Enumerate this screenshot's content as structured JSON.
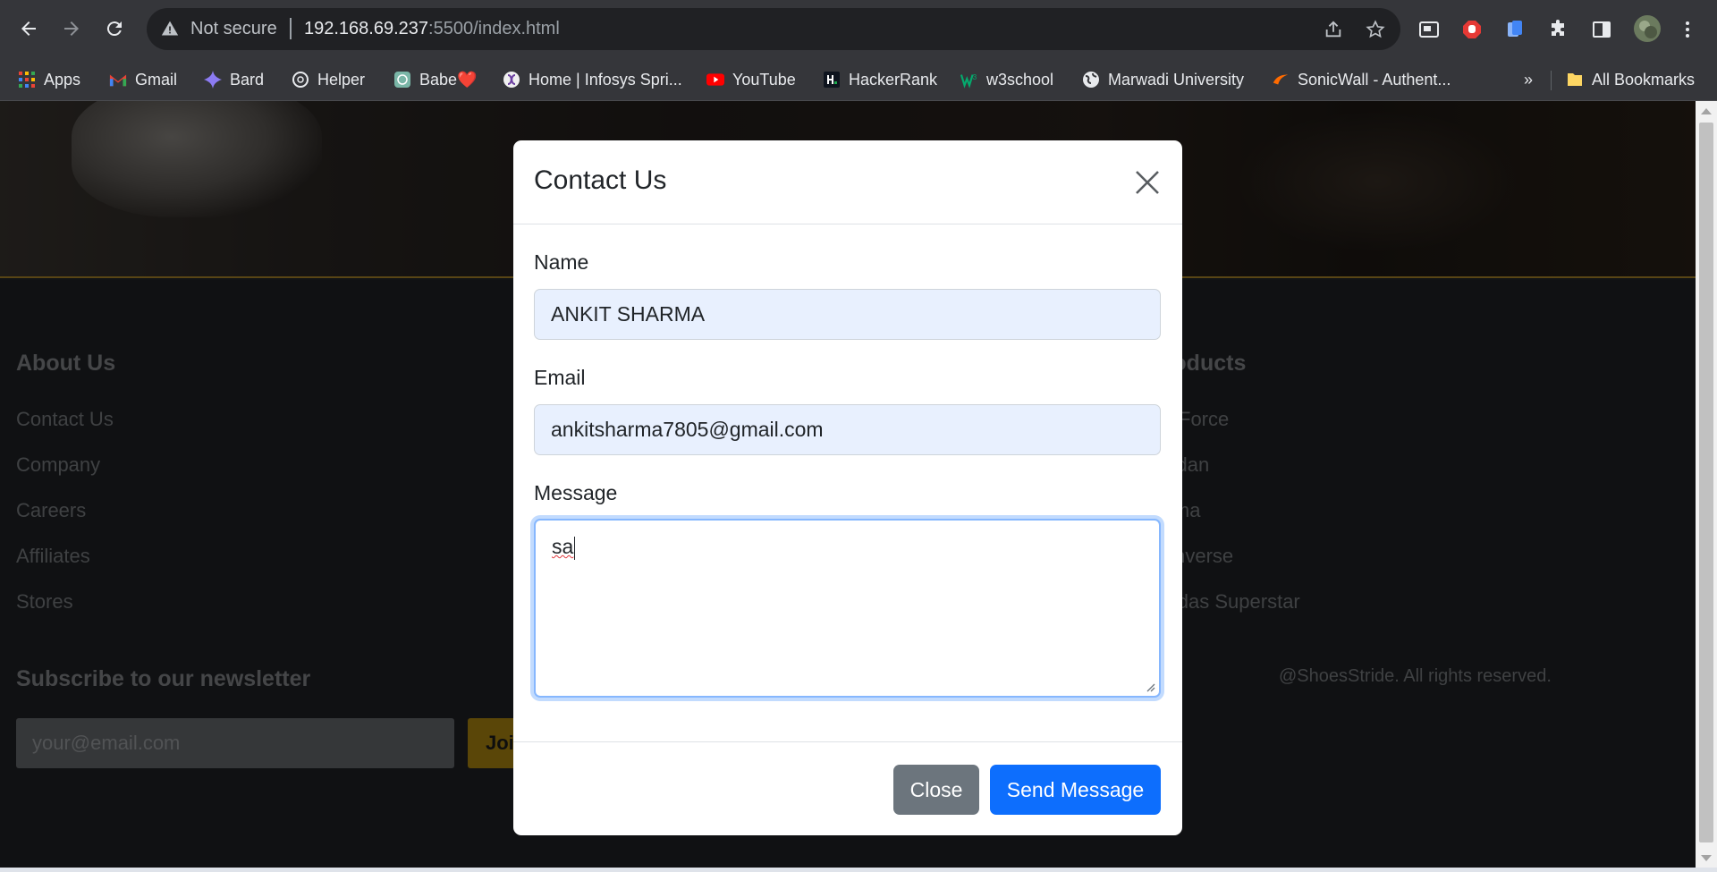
{
  "browser": {
    "security_label": "Not secure",
    "url_host": "192.168.69.237",
    "url_rest": ":5500/index.html"
  },
  "bookmarks": {
    "items": [
      {
        "label": "Apps",
        "icon": "apps-grid-icon"
      },
      {
        "label": "Gmail",
        "icon": "gmail-icon"
      },
      {
        "label": "Bard",
        "icon": "bard-sparkle-icon"
      },
      {
        "label": "Helper",
        "icon": "openai-icon"
      },
      {
        "label": "Babe❤️",
        "icon": "openai-icon"
      },
      {
        "label": "Home | Infosys Spri...",
        "icon": "infosys-icon"
      },
      {
        "label": "YouTube",
        "icon": "youtube-icon"
      },
      {
        "label": "HackerRank",
        "icon": "hackerrank-icon"
      },
      {
        "label": "w3school",
        "icon": "w3schools-icon"
      },
      {
        "label": "Marwadi University",
        "icon": "globe-icon"
      },
      {
        "label": "SonicWall - Authent...",
        "icon": "sonicwall-icon"
      }
    ],
    "overflow": "»",
    "all_bookmarks": "All Bookmarks"
  },
  "footer": {
    "about_heading": "About Us",
    "about_links": [
      "Contact Us",
      "Company",
      "Careers",
      "Affiliates",
      "Stores"
    ],
    "products_heading": "Products",
    "product_links": [
      "Air Force",
      "Jordan",
      "Puma",
      "Converse",
      "Adidas Superstar"
    ],
    "newsletter_heading": "Subscribe to our newsletter",
    "newsletter_placeholder": "your@email.com",
    "join_label": "Join",
    "copyright": "@ShoesStride. All rights reserved."
  },
  "modal": {
    "title": "Contact Us",
    "name_label": "Name",
    "name_value": "ANKIT SHARMA",
    "email_label": "Email",
    "email_value": "ankitsharma7805@gmail.com",
    "message_label": "Message",
    "message_value": "sa",
    "close_label": "Close",
    "send_label": "Send Message"
  },
  "colors": {
    "primary": "#0d6efd",
    "secondary": "#6c757d",
    "accent_gold": "#b58c10"
  }
}
